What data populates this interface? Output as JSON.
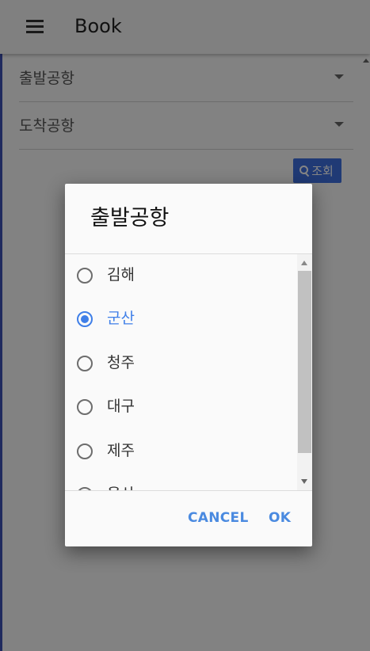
{
  "app": {
    "title": "Book"
  },
  "form": {
    "departure_label": "출발공항",
    "arrival_label": "도착공항",
    "search_label": "조회"
  },
  "dialog": {
    "title": "출발공항",
    "options": [
      {
        "label": "김해",
        "selected": false
      },
      {
        "label": "군산",
        "selected": true
      },
      {
        "label": "청주",
        "selected": false
      },
      {
        "label": "대구",
        "selected": false
      },
      {
        "label": "제주",
        "selected": false
      },
      {
        "label": "울산",
        "selected": false
      }
    ],
    "cancel_label": "CANCEL",
    "ok_label": "OK"
  },
  "colors": {
    "accent": "#3f7fe8",
    "button_text": "#4a8ae0",
    "search_button": "#3f6fe0"
  },
  "icons": {
    "menu": "hamburger-menu-icon",
    "search": "search-icon",
    "dropdown": "chevron-down-icon"
  }
}
